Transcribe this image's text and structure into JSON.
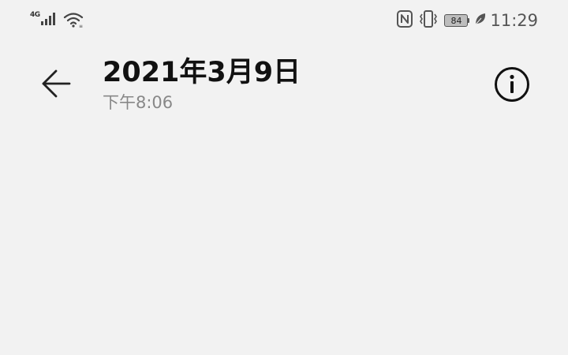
{
  "status_bar": {
    "network_type": "4G",
    "signal_icon": "cellular-signal-icon",
    "wifi_icon": "wifi-icon",
    "nfc_icon": "nfc-icon",
    "vibrate_icon": "vibrate-icon",
    "battery_level": "84",
    "battery_saver_icon": "leaf-icon",
    "time": "11:29"
  },
  "header": {
    "back_icon": "arrow-left-icon",
    "title": "2021年3月9日",
    "subtitle": "下午8:06",
    "info_icon": "info-icon"
  },
  "colors": {
    "background": "#f2f2f2",
    "title": "#111111",
    "subtitle": "#888888",
    "status_text": "#555555"
  }
}
